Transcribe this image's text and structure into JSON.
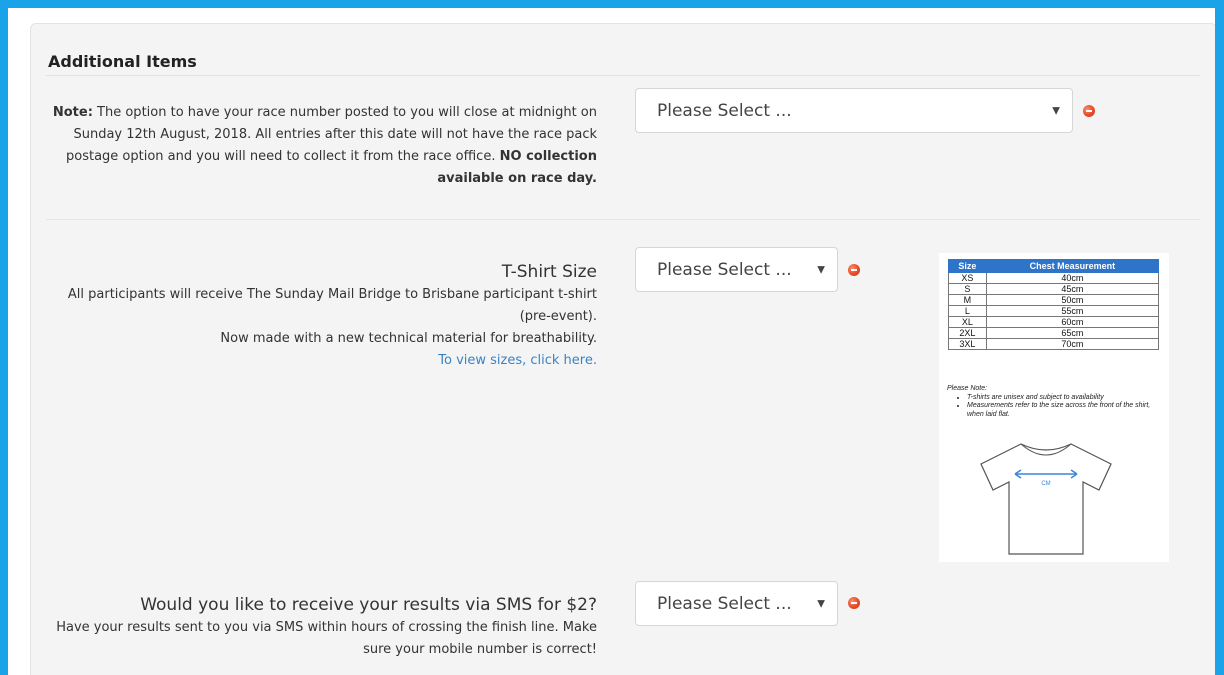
{
  "section": {
    "title": "Additional Items"
  },
  "rows": [
    {
      "note_bold": "Note:",
      "note_text": "The option to have your race number posted to you will close at midnight on Sunday 12th August, 2018. All entries after this date will not have the race pack postage option and you will need to collect it from the race office.",
      "note_strong": "NO collection available on race day.",
      "select_value": "Please Select ..."
    },
    {
      "label": "T-Shirt Size",
      "desc1": "All participants will receive The Sunday Mail Bridge to Brisbane participant t-shirt (pre-event).",
      "desc2": "Now made with a new technical material for breathability.",
      "link": "To view sizes, click here.",
      "select_value": "Please Select ..."
    },
    {
      "label": "Would you like to receive your results via SMS for $2?",
      "desc": "Have your results sent to you via SMS within hours of crossing the finish line. Make sure your mobile number is correct!",
      "select_value": "Please Select ..."
    }
  ],
  "size_chart": {
    "headers": [
      "Size",
      "Chest Measurement"
    ],
    "rows": [
      [
        "XS",
        "40cm"
      ],
      [
        "S",
        "45cm"
      ],
      [
        "M",
        "50cm"
      ],
      [
        "L",
        "55cm"
      ],
      [
        "XL",
        "60cm"
      ],
      [
        "2XL",
        "65cm"
      ],
      [
        "3XL",
        "70cm"
      ]
    ],
    "note_title": "Please Note:",
    "bullets": [
      "T-shirts are unisex and subject to availability",
      "Measurements refer to the size across the front of the shirt, when laid flat."
    ],
    "diagram_label": "CM"
  },
  "colors": {
    "border": "#1aa3e8",
    "required": "#e54b2a",
    "link": "#3b82c4",
    "table_header": "#2e74c9"
  },
  "icons": {
    "select_arrow": "triangle-down",
    "required": "required-dot-icon"
  }
}
